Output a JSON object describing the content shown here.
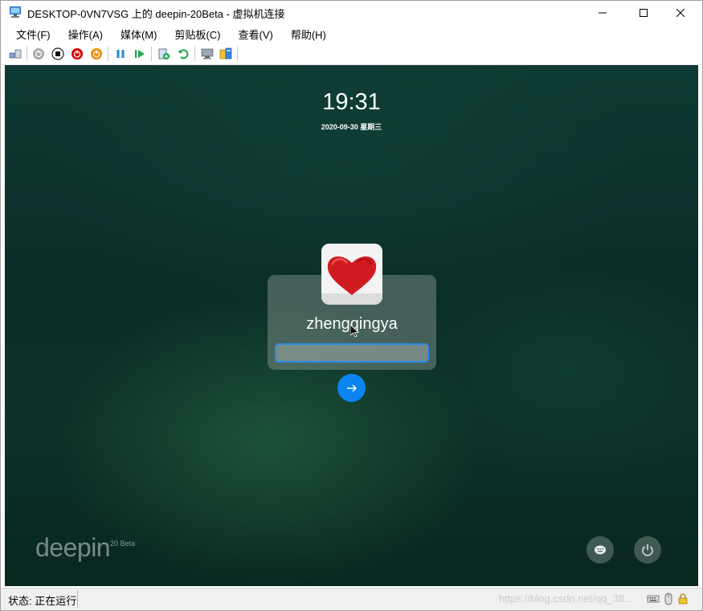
{
  "window": {
    "title": "DESKTOP-0VN7VSG 上的 deepin-20Beta - 虚拟机连接",
    "app_icon": "vm-connection-icon"
  },
  "menu": {
    "items": [
      "文件(F)",
      "操作(A)",
      "媒体(M)",
      "剪贴板(C)",
      "查看(V)",
      "帮助(H)"
    ]
  },
  "toolbar": {
    "buttons": [
      "ctrl-alt-del-icon",
      "start-icon",
      "turn-off-icon",
      "shut-down-icon",
      "save-icon",
      "pause-icon",
      "resume-icon",
      "checkpoint-icon",
      "revert-icon",
      "enhanced-session-icon",
      "share-icon"
    ]
  },
  "lock_screen": {
    "time": "19:31",
    "date": "2020-09-30 星期三",
    "username": "zhengqingya",
    "password_value": "",
    "logo_text": "deepin",
    "logo_version": "20 Beta"
  },
  "status": {
    "text": "状态: 正在运行",
    "watermark": "https://blog.csdn.net/qq_38..."
  },
  "colors": {
    "accent": "#0a84ef",
    "stop_red": "#d40000",
    "power_orange": "#f08c00",
    "pause_blue": "#1e88d8",
    "play_green": "#1ea84a"
  }
}
